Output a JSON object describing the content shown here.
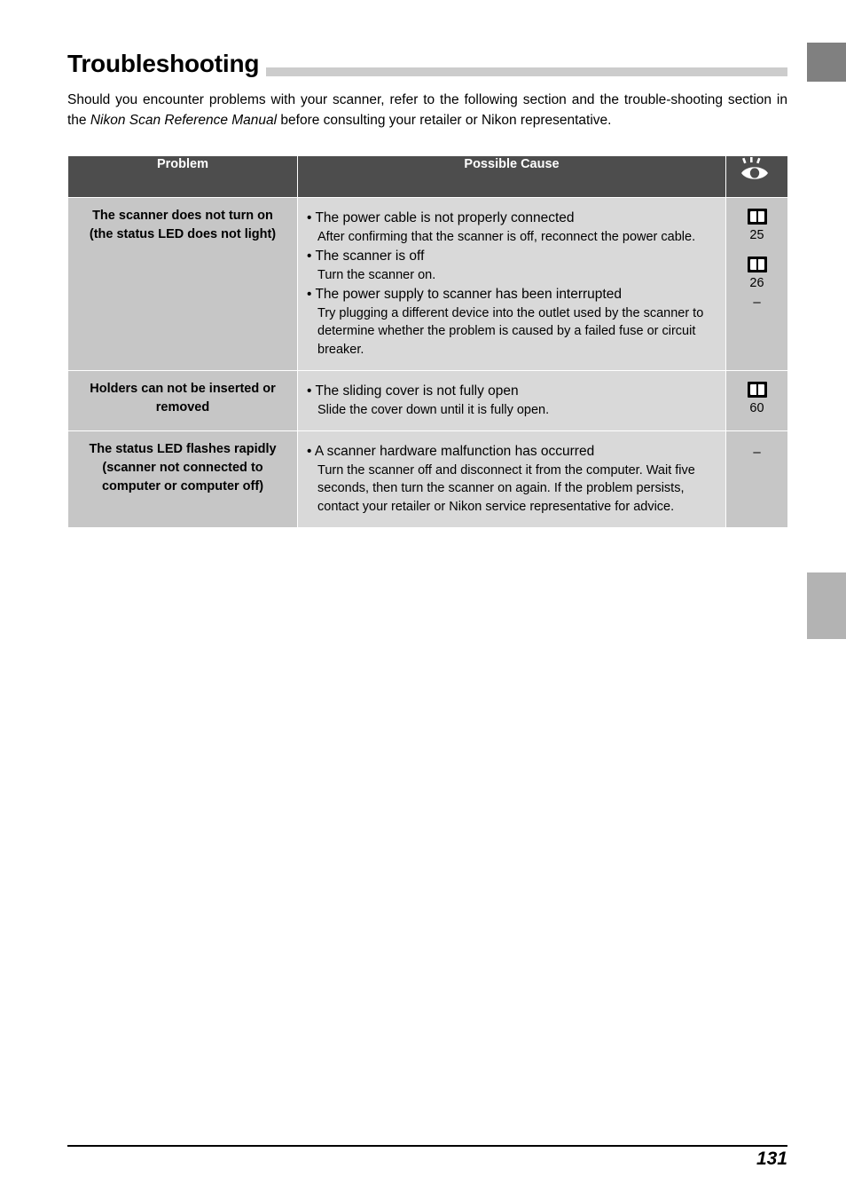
{
  "page": {
    "title": "Troubleshooting",
    "intro_part1": "Should you encounter problems with your scanner, refer to the following section and the trouble-shooting section in the ",
    "intro_italic": "Nikon Scan Reference Manual",
    "intro_part2": " before consulting your retailer or Nikon representative.",
    "folio": "131"
  },
  "table": {
    "headers": {
      "problem": "Problem",
      "cause": "Possible Cause",
      "reference": "eye-icon"
    },
    "rows": [
      {
        "problem": "The scanner does not turn on (the status LED does not light)",
        "causes": [
          {
            "bullet": "• The power cable is not properly connected",
            "detail": "After confirming that the scanner is off, reconnect the power cable."
          },
          {
            "bullet": "• The scanner is off",
            "detail": "Turn the scanner on."
          },
          {
            "bullet": "• The power supply to scanner has been interrupted",
            "detail": "Try plugging a different device into the outlet used by the scanner to determine whether the problem is caused by a failed fuse or circuit breaker."
          }
        ],
        "refs": [
          "25",
          "26",
          "–"
        ]
      },
      {
        "problem": "Holders can not be inserted or removed",
        "causes": [
          {
            "bullet": "• The sliding cover is not fully open",
            "detail": "Slide the cover down until it is fully open."
          }
        ],
        "refs": [
          "60"
        ]
      },
      {
        "problem": "The status LED flashes rapidly (scanner not connected to computer or computer off)",
        "causes": [
          {
            "bullet": "• A scanner hardware malfunction has occurred",
            "detail": "Turn the scanner off and disconnect it from the computer.  Wait five seconds, then turn the scanner on again.  If the problem persists, contact your retailer or Nikon service representative for advice."
          }
        ],
        "refs": [
          "–"
        ]
      }
    ]
  },
  "colors": {
    "header_bg": "#4d4d4d",
    "problem_bg": "#c6c6c6",
    "cause_bg": "#d9d9d9",
    "tab_dark": "#808080",
    "tab_light": "#b3b3b3"
  }
}
